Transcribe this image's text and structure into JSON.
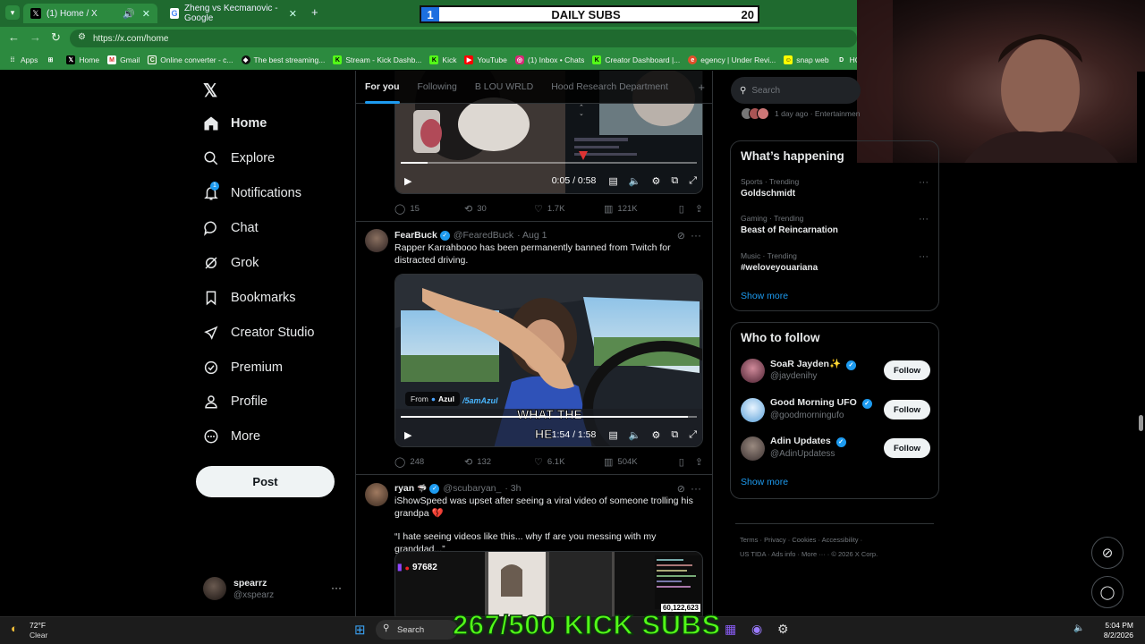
{
  "browser": {
    "tabs": [
      {
        "label": "(1) Home / X",
        "active": true
      },
      {
        "label": "Zheng vs Kecmanovic - Google",
        "active": false
      }
    ],
    "new_tab": "+",
    "url": "https://x.com/home",
    "bookmarks": [
      "Apps",
      "Home",
      "Gmail",
      "Online converter - c...",
      "The best streaming...",
      "Stream - Kick Dashb...",
      "Kick",
      "YouTube",
      "(1) Inbox • Chats",
      "Creator Dashboard |...",
      "egency | Under Revi...",
      "snap web",
      "HOM"
    ]
  },
  "overlay": {
    "daily_subs_left": "1",
    "daily_subs_title": "DAILY SUBS",
    "daily_subs_right": "20",
    "kick_subs": "267/500 KICK SUBS"
  },
  "nav": {
    "items": [
      "Home",
      "Explore",
      "Notifications",
      "Chat",
      "Grok",
      "Bookmarks",
      "Creator Studio",
      "Premium",
      "Profile",
      "More"
    ],
    "notifications_badge": "1",
    "post_label": "Post",
    "account_name": "spearrz",
    "account_handle": "@xspearz"
  },
  "timeline": {
    "tabs": [
      "For you",
      "Following",
      "B LOU WRLD",
      "Hood Research Department"
    ],
    "add_tab": "+",
    "tweets": [
      {
        "video_time": "0:05 / 0:58",
        "video_progress": 0.09,
        "replies": "15",
        "reposts": "30",
        "likes": "1.7K",
        "views": "121K"
      },
      {
        "name": "FearBuck",
        "handle": "@FearedBuck",
        "date": "· Aug 1",
        "text": "Rapper Karrahbooo has been permanently banned from Twitch for distracted driving.",
        "video_from": "From",
        "video_from_name": "Azul",
        "video_caption_1": "WHAT THE",
        "video_caption_2": "HE",
        "video_watermark": "/5amAzul",
        "video_time": "1:54 / 1:58",
        "video_progress": 0.97,
        "replies": "248",
        "reposts": "132",
        "likes": "6.1K",
        "views": "504K"
      },
      {
        "name": "ryan",
        "handle": "@scubaryan_",
        "date": "· 3h",
        "text": "iShowSpeed was upset after seeing a viral video of someone trolling his grandpa 💔",
        "quote": "“I hate seeing videos like this... why tf are you messing with my granddad...”",
        "viewer_count": "97682",
        "total_count": "60,122,623"
      }
    ]
  },
  "sidebar": {
    "search_placeholder": "Search",
    "top_meta": "1 day ago · Entertainmen",
    "whats_happening_title": "What’s happening",
    "trends": [
      {
        "meta": "Sports · Trending",
        "name": "Goldschmidt"
      },
      {
        "meta": "Gaming · Trending",
        "name": "Beast of Reincarnation"
      },
      {
        "meta": "Music · Trending",
        "name": "#weloveyouariana"
      }
    ],
    "show_more": "Show more",
    "who_to_follow_title": "Who to follow",
    "follow_suggestions": [
      {
        "name": "SoaR Jayden✨",
        "handle": "@jaydenihy"
      },
      {
        "name": "Good Morning UFO",
        "handle": "@goodmorningufo"
      },
      {
        "name": "Adin Updates",
        "handle": "@AdinUpdatess"
      }
    ],
    "follow_label": "Follow",
    "footer_line1": "Terms · Privacy · Cookies · Accessibility ·",
    "footer_line2": "US TIDA · Ads info · More ··· · © 2026 X Corp."
  },
  "taskbar": {
    "weather_temp": "72°F",
    "weather_desc": "Clear",
    "search": "Search",
    "time": "5:04 PM",
    "date": "8/2/2026"
  },
  "colors": {
    "accent": "#1d9bf0",
    "chrome": "#2c8a3f",
    "kick_green": "#53fc18"
  }
}
